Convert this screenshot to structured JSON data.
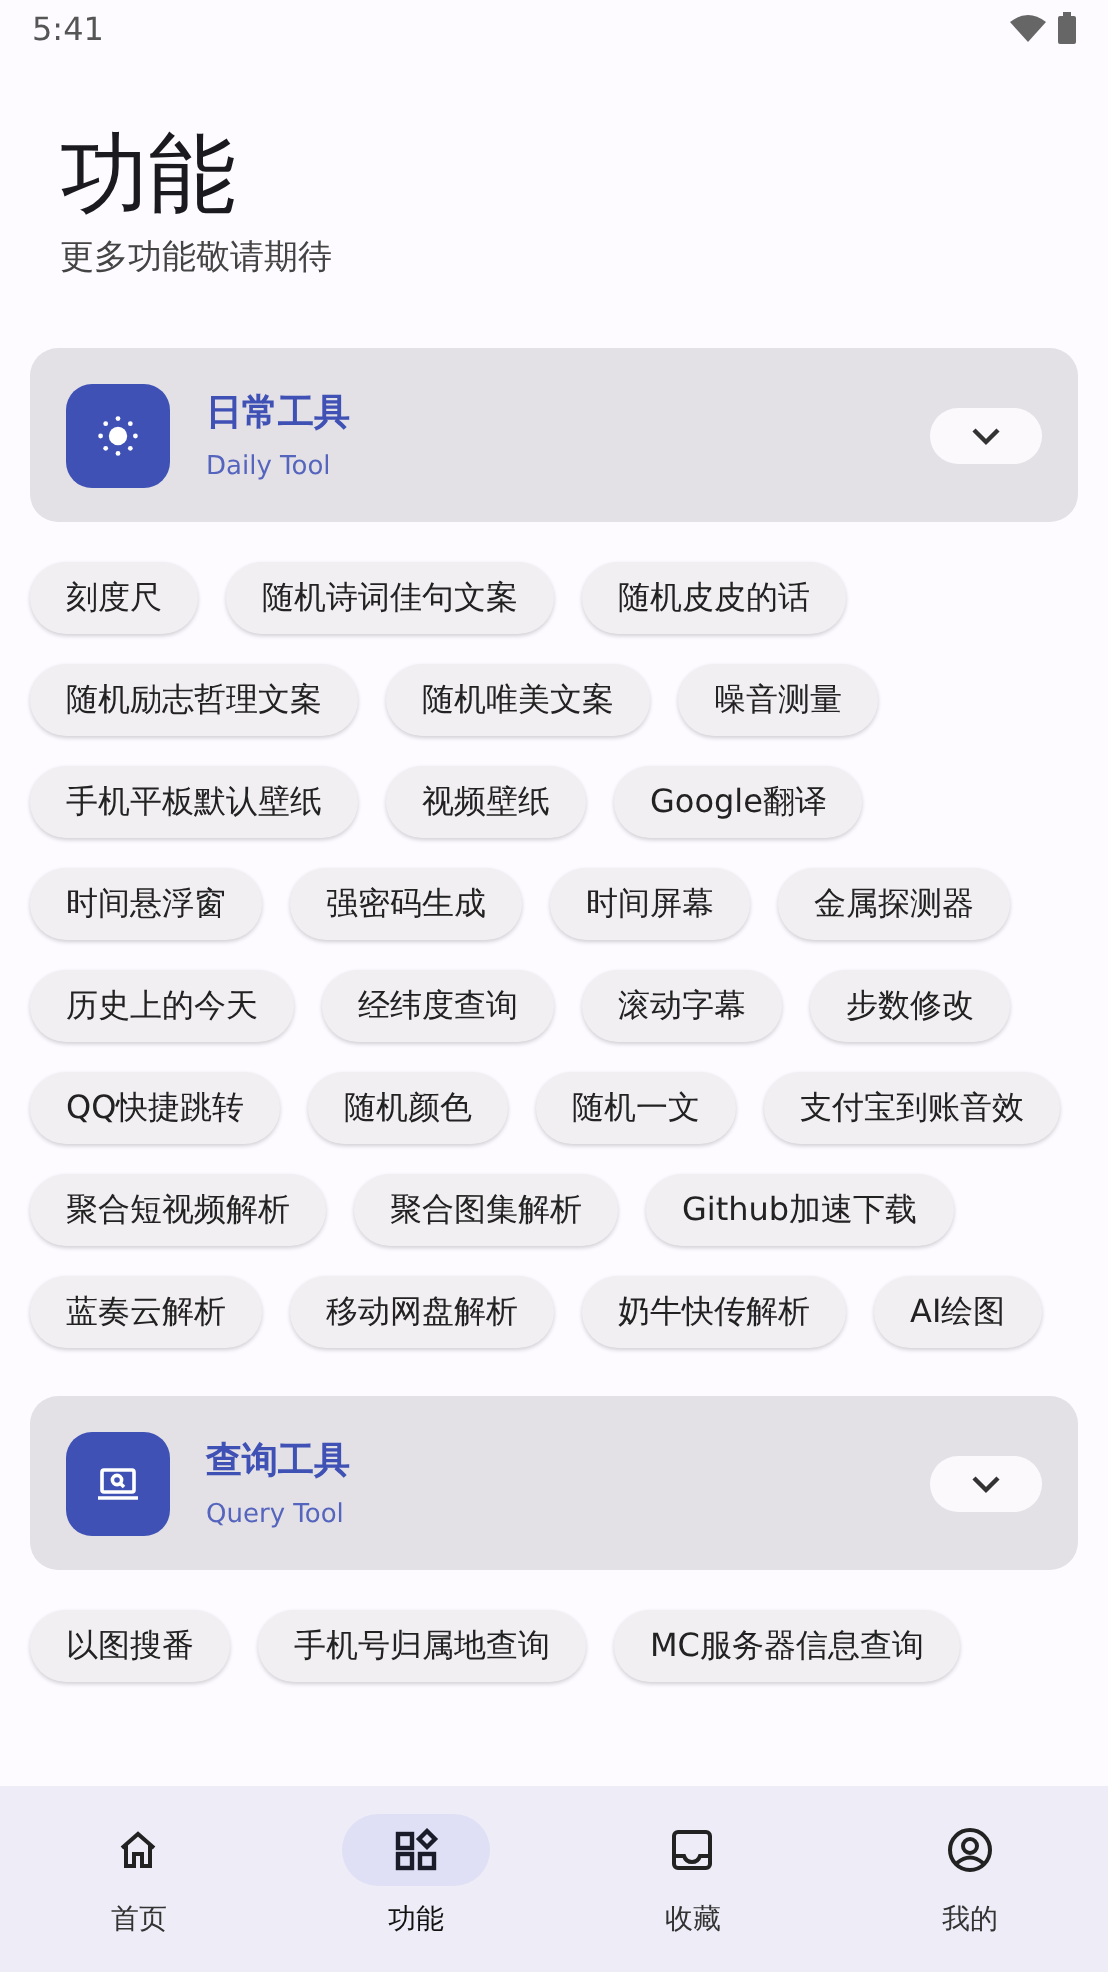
{
  "status_bar": {
    "time": "5:41"
  },
  "header": {
    "title": "功能",
    "subtitle": "更多功能敬请期待"
  },
  "sections": [
    {
      "kind": "sun",
      "title": "日常工具",
      "subtitle": "Daily Tool",
      "tools": [
        "刻度尺",
        "随机诗词佳句文案",
        "随机皮皮的话",
        "随机励志哲理文案",
        "随机唯美文案",
        "噪音测量",
        "手机平板默认壁纸",
        "视频壁纸",
        "Google翻译",
        "时间悬浮窗",
        "强密码生成",
        "时间屏幕",
        "金属探测器",
        "历史上的今天",
        "经纬度查询",
        "滚动字幕",
        "步数修改",
        "QQ快捷跳转",
        "随机颜色",
        "随机一文",
        "支付宝到账音效",
        "聚合短视频解析",
        "聚合图集解析",
        "Github加速下载",
        "蓝奏云解析",
        "移动网盘解析",
        "奶牛快传解析",
        "AI绘图"
      ]
    },
    {
      "kind": "laptop",
      "title": "查询工具",
      "subtitle": "Query Tool",
      "tools": [
        "以图搜番",
        "手机号归属地查询",
        "MC服务器信息查询"
      ]
    }
  ],
  "nav": [
    {
      "kind": "home",
      "label": "首页",
      "selected": false
    },
    {
      "kind": "apps",
      "label": "功能",
      "selected": true
    },
    {
      "kind": "inbox",
      "label": "收藏",
      "selected": false
    },
    {
      "kind": "account",
      "label": "我的",
      "selected": false
    }
  ]
}
